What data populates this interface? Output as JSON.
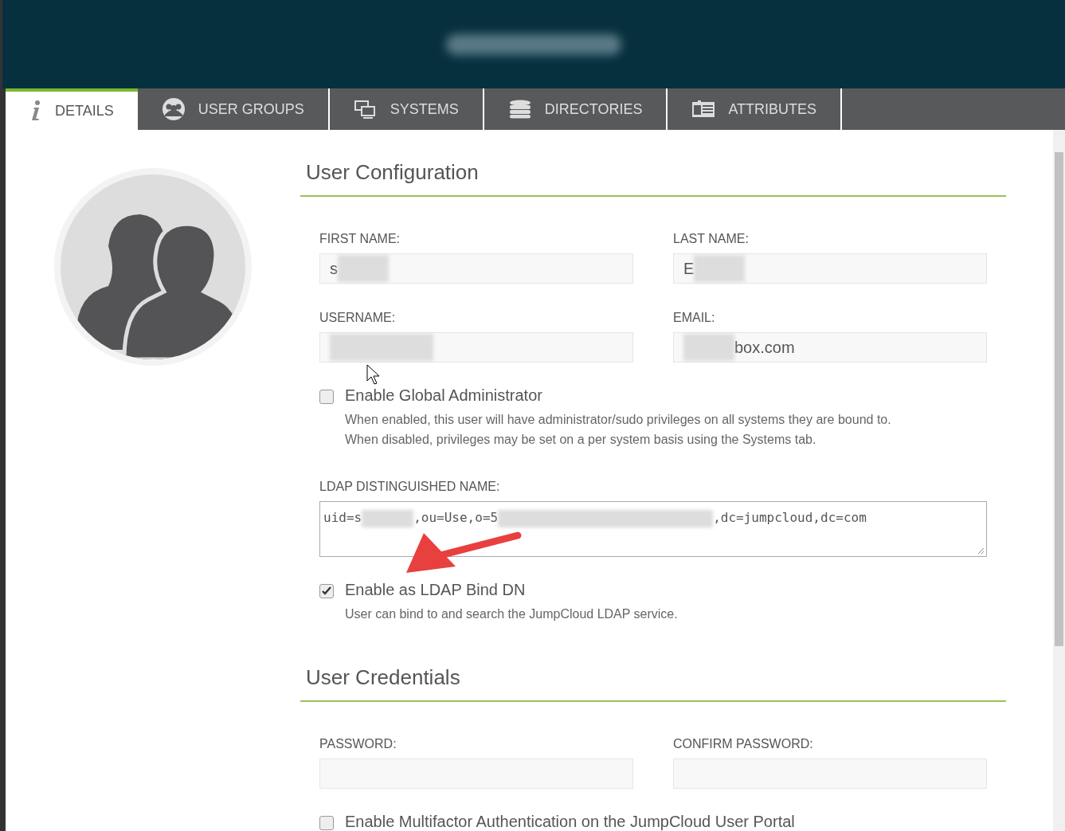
{
  "tabs": [
    {
      "label": "DETAILS",
      "selected": true
    },
    {
      "label": "USER GROUPS",
      "selected": false
    },
    {
      "label": "SYSTEMS",
      "selected": false
    },
    {
      "label": "DIRECTORIES",
      "selected": false
    },
    {
      "label": "ATTRIBUTES",
      "selected": false
    }
  ],
  "user_configuration": {
    "title": "User Configuration",
    "fields": [
      {
        "label": "FIRST NAME:",
        "segments": [
          {
            "kind": "text",
            "text": "s"
          },
          {
            "kind": "redacted"
          }
        ]
      },
      {
        "label": "LAST NAME:",
        "segments": [
          {
            "kind": "text",
            "text": "E"
          },
          {
            "kind": "redacted"
          }
        ]
      },
      {
        "label": "USERNAME:",
        "segments": [
          {
            "kind": "redacted"
          }
        ]
      },
      {
        "label": "EMAIL:",
        "segments": [
          {
            "kind": "redacted"
          },
          {
            "kind": "text",
            "text": "box.com"
          }
        ]
      }
    ],
    "global_admin": {
      "label": "Enable Global Administrator",
      "checked": false,
      "description": [
        "When enabled, this user will have administrator/sudo privileges on all systems they are bound to.",
        "When disabled, privileges may be set on a per system basis using the Systems tab."
      ]
    },
    "ldap_dn": {
      "label": "LDAP DISTINGUISHED NAME:",
      "segments": [
        {
          "kind": "text",
          "text": "uid=s"
        },
        {
          "kind": "redacted"
        },
        {
          "kind": "text",
          "text": ",ou=Use"
        },
        {
          "kind": "text",
          "text": ",o=5"
        },
        {
          "kind": "redacted"
        },
        {
          "kind": "text",
          "text": ",dc=jumpcloud,dc=com"
        }
      ]
    },
    "ldap_bind": {
      "label": "Enable as LDAP Bind DN",
      "checked": true,
      "description": [
        "User can bind to and search the JumpCloud LDAP service."
      ]
    }
  },
  "user_credentials": {
    "title": "User Credentials",
    "fields": [
      {
        "label": "PASSWORD:"
      },
      {
        "label": "CONFIRM PASSWORD:"
      }
    ],
    "mfa": {
      "label": "Enable Multifactor Authentication on the JumpCloud User Portal",
      "checked": false
    }
  }
}
